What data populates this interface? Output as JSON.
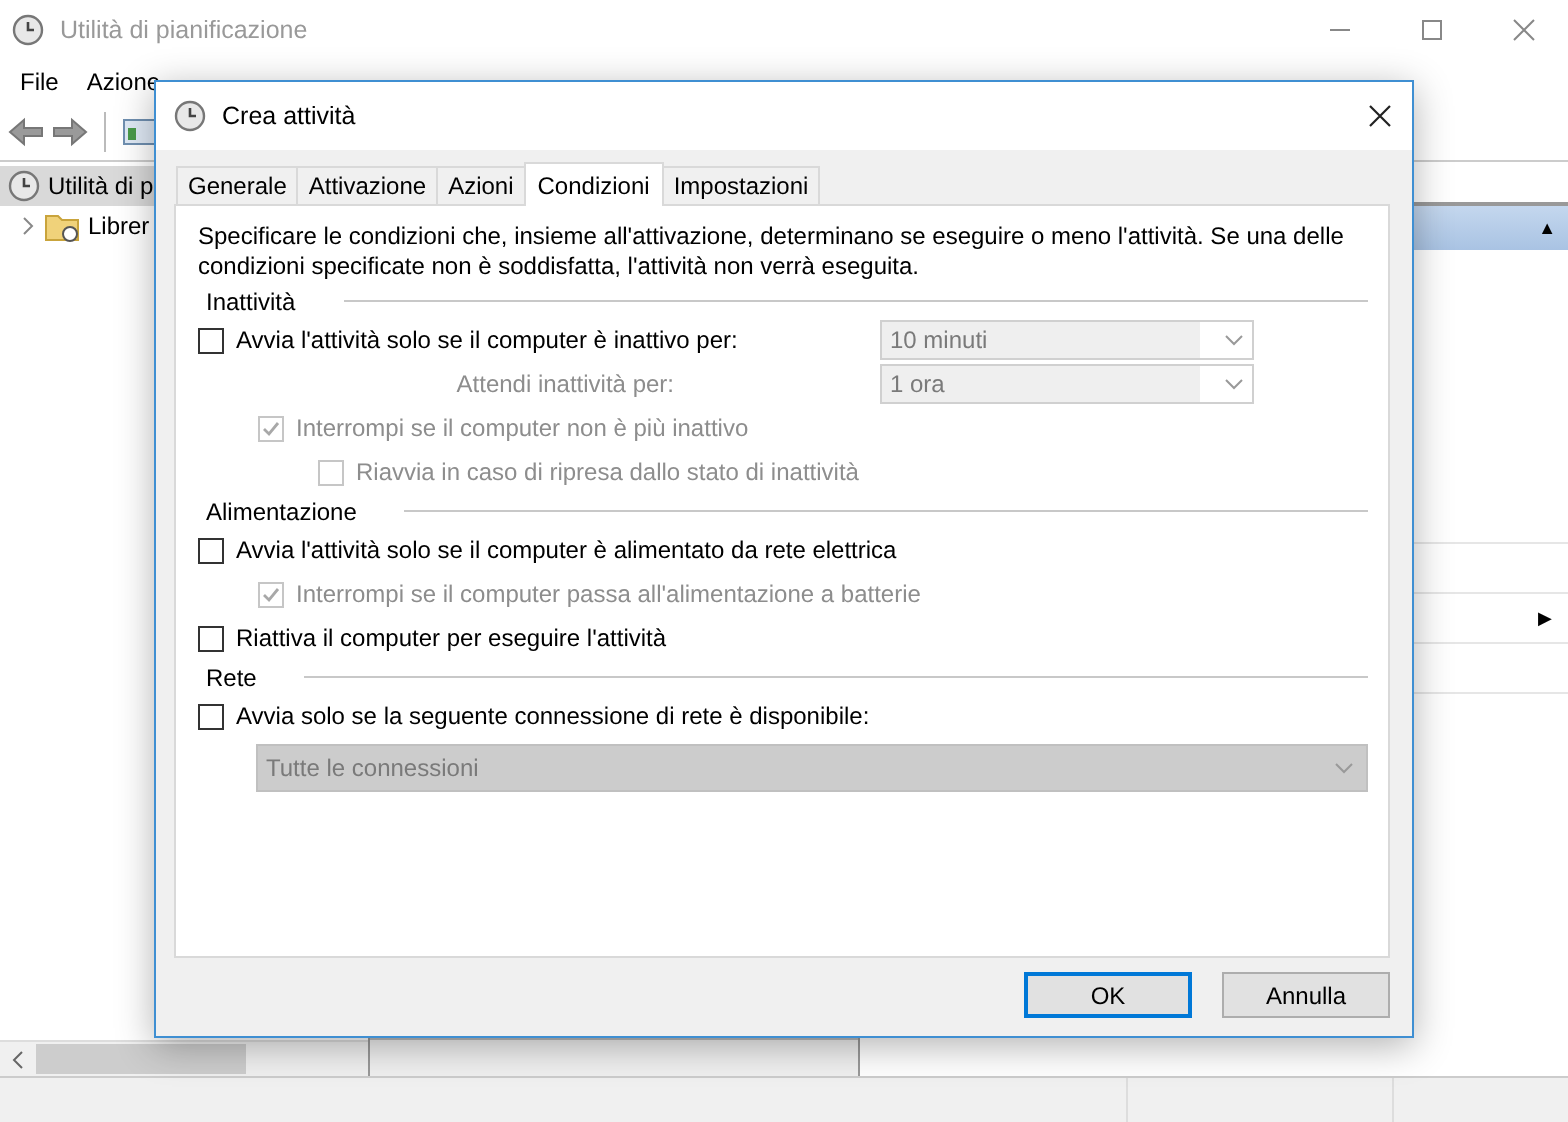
{
  "window": {
    "title": "Utilità di pianificazione"
  },
  "menu": [
    {
      "label": "File"
    },
    {
      "label": "Azione"
    }
  ],
  "tree": [
    {
      "label": "Utilità di p",
      "selected": true,
      "children": [
        {
          "label": "Librer",
          "selected": false,
          "expanded": false
        }
      ]
    }
  ],
  "actions_pane": {
    "header_glyph": "▲",
    "submenu_glyph": "▶"
  },
  "dialog": {
    "title": "Crea attività",
    "tabs": [
      {
        "label": "Generale",
        "selected": false
      },
      {
        "label": "Attivazione",
        "selected": false
      },
      {
        "label": "Azioni",
        "selected": false
      },
      {
        "label": "Condizioni",
        "selected": true
      },
      {
        "label": "Impostazioni",
        "selected": false
      }
    ],
    "description": "Specificare le condizioni che, insieme all'attivazione, determinano se eseguire o meno l'attività. Se una delle condizioni specificate non è soddisfatta, l'attività non verrà eseguita.",
    "groups": [
      {
        "title": "Inattività",
        "rows": [
          {
            "kind": "checkbox",
            "label": "Avvia l'attività solo se il computer è inattivo per:",
            "checked": false,
            "disabled": false,
            "dropdown": {
              "value": "10 minuti",
              "disabled": true
            },
            "children": [
              {
                "kind": "label",
                "label": "Attendi inattività per:",
                "disabled": true,
                "dropdown": {
                  "value": "1 ora",
                  "disabled": true
                }
              },
              {
                "kind": "checkbox",
                "label": "Interrompi se il computer non è più inattivo",
                "checked": true,
                "disabled": true,
                "children": [
                  {
                    "kind": "checkbox",
                    "label": "Riavvia in caso di ripresa dallo stato di inattività",
                    "checked": false,
                    "disabled": true
                  }
                ]
              }
            ]
          }
        ]
      },
      {
        "title": "Alimentazione",
        "rows": [
          {
            "kind": "checkbox",
            "label": "Avvia l'attività solo se il computer è alimentato da rete elettrica",
            "checked": false,
            "disabled": false,
            "children": [
              {
                "kind": "checkbox",
                "label": "Interrompi se il computer passa all'alimentazione a batterie",
                "checked": true,
                "disabled": true
              }
            ]
          },
          {
            "kind": "checkbox",
            "label": "Riattiva il computer per eseguire l'attività",
            "checked": false,
            "disabled": false
          }
        ]
      },
      {
        "title": "Rete",
        "rows": [
          {
            "kind": "checkbox",
            "label": "Avvia solo se la seguente connessione di rete è disponibile:",
            "checked": false,
            "disabled": false,
            "children": [
              {
                "kind": "dropdown",
                "value": "Tutte le connessioni",
                "disabled": true
              }
            ]
          }
        ]
      }
    ],
    "buttons": [
      {
        "label": "OK",
        "default": true
      },
      {
        "label": "Annulla",
        "default": false
      }
    ]
  }
}
